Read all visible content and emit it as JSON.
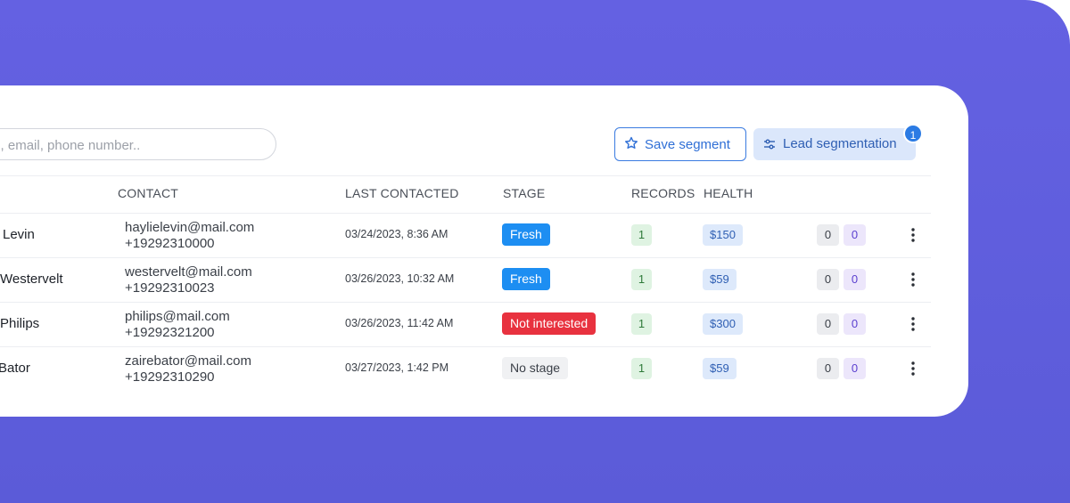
{
  "search": {
    "placeholder": "ch by name, email, phone number.."
  },
  "toolbar": {
    "save_label": "Save segment",
    "lead_label": "Lead segmentation",
    "lead_badge": "1"
  },
  "columns": {
    "contact": "CONTACT",
    "last_contacted": "LAST CONTACTED",
    "stage": "STAGE",
    "records": "RECORDS",
    "health": "HEALTH"
  },
  "colors": {
    "background": "#6461e2",
    "accent": "#2b7be4",
    "stage_fresh": "#1d8ef2",
    "stage_not_interested": "#e8323f"
  },
  "rows": [
    {
      "name": "Levin",
      "email": "haylielevin@mail.com",
      "phone": "+19292310000",
      "last_contacted": "03/24/2023, 8:36 AM",
      "stage": "Fresh",
      "records": "1",
      "health": "$150",
      "count_a": "0",
      "count_b": "0"
    },
    {
      "name": "Westervelt",
      "email": "westervelt@mail.com",
      "phone": "+19292310023",
      "last_contacted": "03/26/2023, 10:32 AM",
      "stage": "Fresh",
      "records": "1",
      "health": "$59",
      "count_a": "0",
      "count_b": "0"
    },
    {
      "name": "Philips",
      "email": "philips@mail.com",
      "phone": "+19292321200",
      "last_contacted": "03/26/2023, 11:42 AM",
      "stage": "Not interested",
      "records": "1",
      "health": "$300",
      "count_a": "0",
      "count_b": "0"
    },
    {
      "name": "Bator",
      "email": "zairebator@mail.com",
      "phone": "+19292310290",
      "last_contacted": "03/27/2023, 1:42 PM",
      "stage": "No stage",
      "records": "1",
      "health": "$59",
      "count_a": "0",
      "count_b": "0"
    }
  ]
}
